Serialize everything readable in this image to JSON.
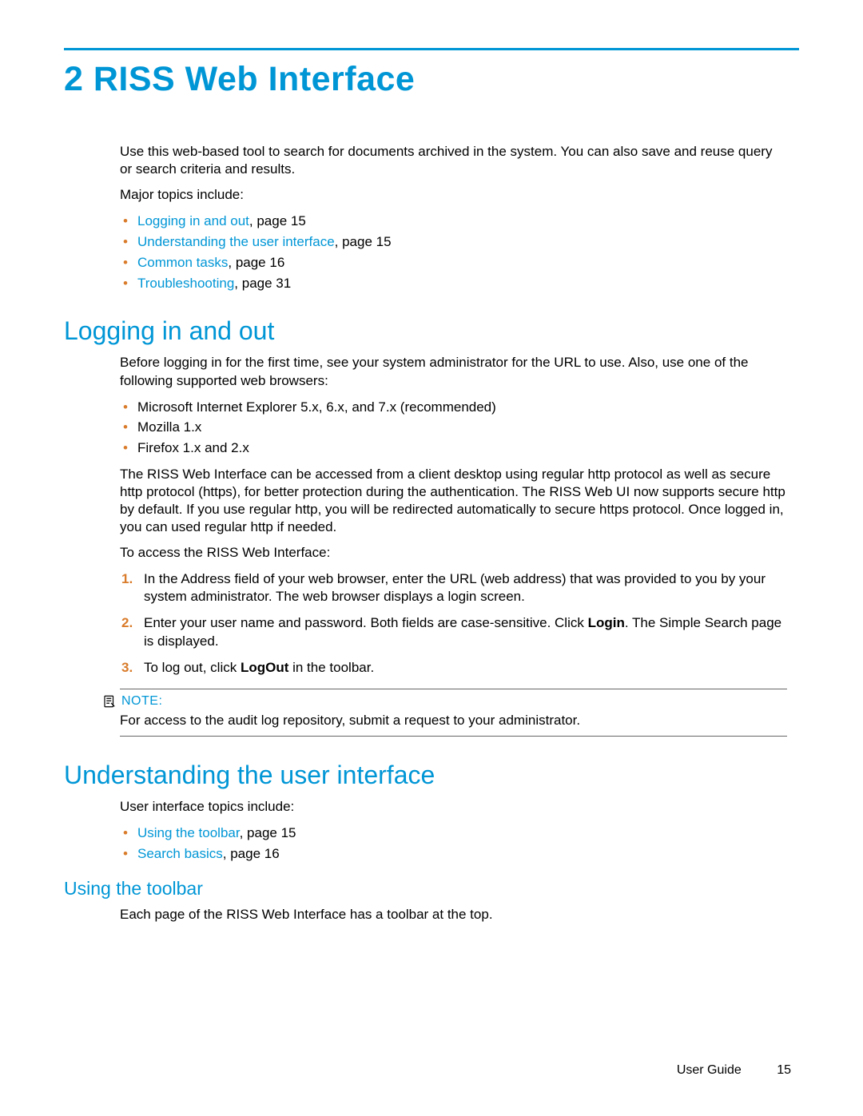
{
  "chapter": {
    "title": "2 RISS Web Interface"
  },
  "intro": {
    "p1": "Use this web-based tool to search for documents archived in the system. You can also save and reuse query or search criteria and results.",
    "p2": "Major topics include:",
    "topics": [
      {
        "link": "Logging in and out",
        "rest": ", page 15"
      },
      {
        "link": "Understanding the user interface",
        "rest": ", page 15"
      },
      {
        "link": "Common tasks",
        "rest": ", page 16"
      },
      {
        "link": "Troubleshooting",
        "rest": ", page 31"
      }
    ]
  },
  "logging": {
    "heading": "Logging in and out",
    "p1": "Before logging in for the first time, see your system administrator for the URL to use. Also, use one of the following supported web browsers:",
    "browsers": [
      "Microsoft Internet Explorer 5.x, 6.x, and 7.x (recommended)",
      "Mozilla 1.x",
      "Firefox 1.x and 2.x"
    ],
    "p2": "The RISS Web Interface can be accessed from a client desktop using regular http protocol as well as secure http protocol (https), for better protection during the authentication. The RISS Web UI now supports secure http by default. If you use regular http, you will be redirected automatically to secure https protocol. Once logged in, you can used regular http if needed.",
    "p3": "To access the RISS Web Interface:",
    "steps": {
      "s1": "In the Address field of your web browser, enter the URL (web address) that was provided to you by your system administrator. The web browser displays a login screen.",
      "s2a": "Enter your user name and password. Both fields are case-sensitive. Click ",
      "s2b": "Login",
      "s2c": ". The Simple Search page is displayed.",
      "s3a": "To log out, click ",
      "s3b": "LogOut",
      "s3c": " in the toolbar."
    },
    "note": {
      "label": "NOTE:",
      "text": "For access to the audit log repository, submit a request to your administrator."
    }
  },
  "understanding": {
    "heading": "Understanding the user interface",
    "p1": "User interface topics include:",
    "topics": [
      {
        "link": "Using the toolbar",
        "rest": ", page 15"
      },
      {
        "link": "Search basics",
        "rest": ", page 16"
      }
    ],
    "sub": {
      "heading": "Using the toolbar",
      "p1": "Each page of the RISS Web Interface has a toolbar at the top."
    }
  },
  "footer": {
    "guide": "User Guide",
    "page": "15"
  }
}
